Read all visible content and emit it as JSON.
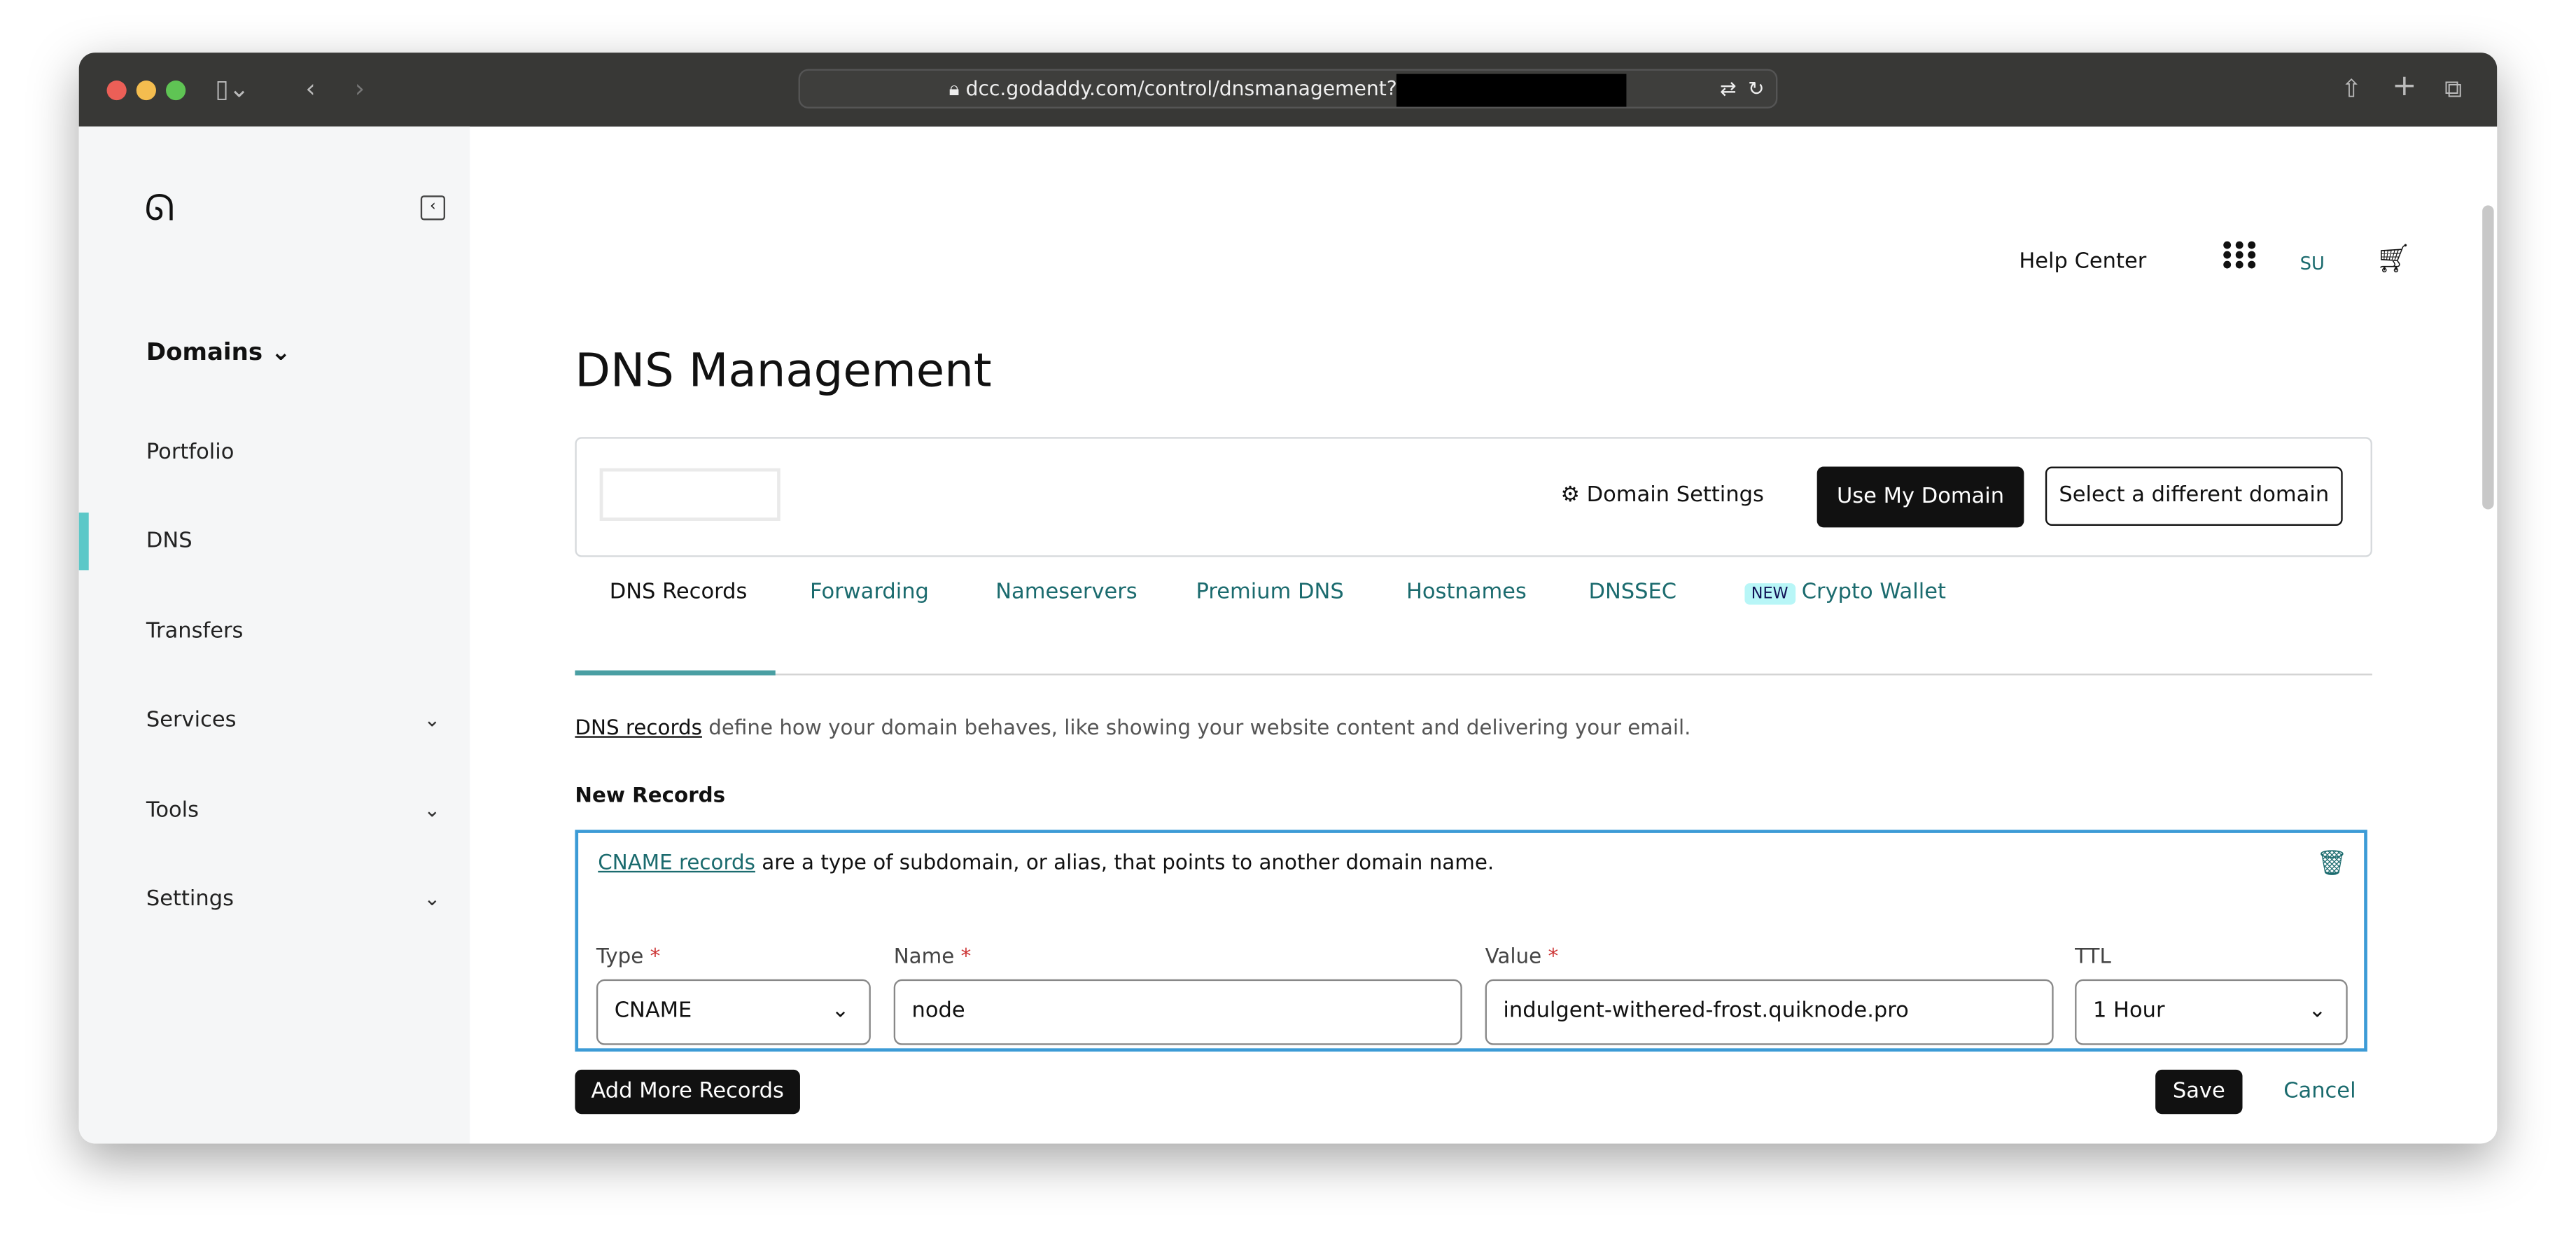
{
  "browser": {
    "url": "dcc.godaddy.com/control/dnsmanagement?",
    "icons": [
      "sidebar-icon",
      "back-icon",
      "forward-icon",
      "lock-icon",
      "translate-icon",
      "reload-icon",
      "share-icon",
      "new-tab-icon",
      "tabs-icon"
    ]
  },
  "sidebar": {
    "section": "Domains",
    "items": [
      {
        "label": "Portfolio"
      },
      {
        "label": "DNS",
        "active": true
      },
      {
        "label": "Transfers"
      },
      {
        "label": "Services",
        "expandable": true
      },
      {
        "label": "Tools",
        "expandable": true
      },
      {
        "label": "Settings",
        "expandable": true
      }
    ]
  },
  "header": {
    "help": "Help Center",
    "user": "SU"
  },
  "page": {
    "title": "DNS Management",
    "domain_settings": "Domain Settings",
    "use_my_domain": "Use My Domain",
    "select_domain": "Select a different domain"
  },
  "tabs": [
    {
      "label": "DNS Records",
      "active": true
    },
    {
      "label": "Forwarding"
    },
    {
      "label": "Nameservers"
    },
    {
      "label": "Premium DNS"
    },
    {
      "label": "Hostnames"
    },
    {
      "label": "DNSSEC"
    },
    {
      "label": "Crypto Wallet",
      "badge": "NEW"
    }
  ],
  "intro": {
    "link": "DNS records",
    "text": " define how your domain behaves, like showing your website content and delivering your email."
  },
  "new_records": {
    "heading": "New Records",
    "info_link": "CNAME records",
    "info_text": " are a type of subdomain, or alias, that points to another domain name.",
    "type": {
      "label": "Type",
      "value": "CNAME"
    },
    "name": {
      "label": "Name",
      "value": "node"
    },
    "value": {
      "label": "Value",
      "value": "indulgent-withered-frost.quiknode.pro"
    },
    "ttl": {
      "label": "TTL",
      "value": "1 Hour"
    },
    "required": "*"
  },
  "actions": {
    "add_more": "Add More Records",
    "save": "Save",
    "cancel": "Cancel"
  },
  "colors": {
    "accent": "#1b6b6e",
    "tab_underline": "#4a9fa3",
    "selected_border": "#3c9bd6",
    "new_badge": "#b8f6f7"
  }
}
